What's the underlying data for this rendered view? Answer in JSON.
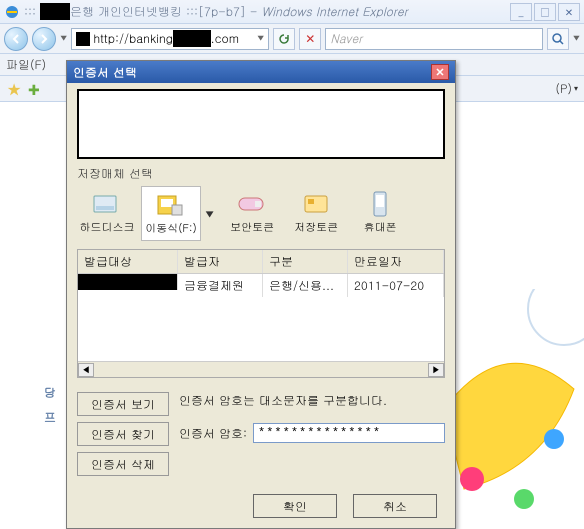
{
  "browser": {
    "title_prefix": "::: ",
    "title_bank": "은행 개인인터넷뱅킹",
    "title_mid": " :::[7p-b7] - ",
    "title_app": "Windows Internet Explorer",
    "url_prefix": "http://banking",
    "url_suffix": ".com",
    "search_placeholder": "Naver",
    "menu_file": "파일(F)",
    "right_p": "(P)"
  },
  "dialog": {
    "title": "인증서 선택",
    "media_label": "저장매체 선택",
    "media": [
      {
        "label": "하드디스크"
      },
      {
        "label": "이동식(F:)"
      },
      {
        "label": "보안토큰"
      },
      {
        "label": "저장토큰"
      },
      {
        "label": "휴대폰"
      }
    ],
    "columns": {
      "c1": "발급대상",
      "c2": "발급자",
      "c3": "구분",
      "c4": "만료일자"
    },
    "row": {
      "issuer": "금융결제원",
      "type": "은행/신용...",
      "expiry": "2011-07-20"
    },
    "side": {
      "view": "인증서 보기",
      "find": "인증서 찾기",
      "delete": "인증서 삭제"
    },
    "hint": "인증서 암호는 대소문자를 구분합니다.",
    "pw_label": "인증서 암호:",
    "pw_value": "***************",
    "ok": "확인",
    "cancel": "취소"
  },
  "page": {
    "line1": "당",
    "line2": "프"
  }
}
